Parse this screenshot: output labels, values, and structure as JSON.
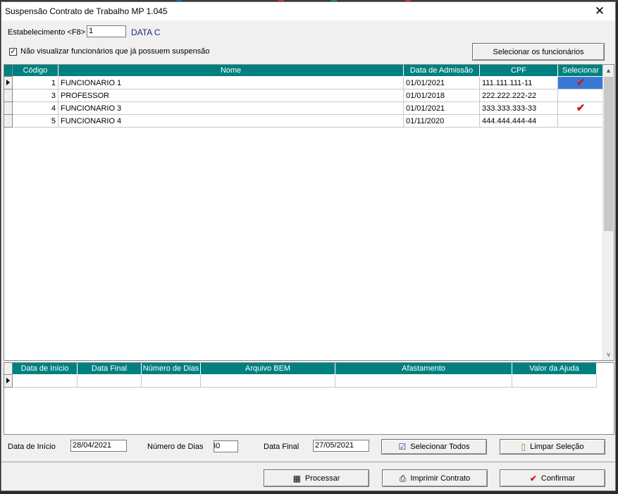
{
  "window": {
    "title": "Suspensão Contrato de Trabalho MP 1.045",
    "close_glyph": "✕"
  },
  "estab": {
    "label": "Estabelecimento <F8>",
    "value": "1",
    "name": "DATA C"
  },
  "filter": {
    "label": "Não visualizar funcionários que já possuem suspensão",
    "checked": true,
    "check_glyph": "✓"
  },
  "select_button": "Selecionar os funcionários",
  "grid": {
    "columns": [
      "Código",
      "Nome",
      "Data de Admissão",
      "CPF",
      "Selecionar"
    ],
    "rows": [
      {
        "codigo": "1",
        "nome": "FUNCIONARIO 1",
        "admissao": "01/01/2021",
        "cpf": "111.111.111-11",
        "selecionar": true
      },
      {
        "codigo": "3",
        "nome": "PROFESSOR",
        "admissao": "01/01/2018",
        "cpf": "222.222.222-22",
        "selecionar": false
      },
      {
        "codigo": "4",
        "nome": "FUNCIONARIO 3",
        "admissao": "01/01/2021",
        "cpf": "333.333.333-33",
        "selecionar": true
      },
      {
        "codigo": "5",
        "nome": "FUNCIONARIO 4",
        "admissao": "01/11/2020",
        "cpf": "444.444.444-44",
        "selecionar": false
      }
    ],
    "check_glyph": "✔",
    "scroll_up": "▲",
    "scroll_down": "∨"
  },
  "periods": {
    "columns": [
      "Data de Início",
      "Data Final",
      "Número de Dias",
      "Arquivo BEM",
      "Afastamento",
      "Valor da Ajuda"
    ]
  },
  "form": {
    "inicio_label": "Data de Início",
    "inicio_value": "28/04/2021",
    "dias_label": "Número de Dias",
    "dias_value": "30",
    "final_label": "Data Final",
    "final_value": "27/05/2021"
  },
  "buttons": {
    "selecionar_todos": "Selecionar Todos",
    "limpar_selecao": "Limpar Seleção",
    "processar": "Processar",
    "imprimir": "Imprimir Contrato",
    "confirmar": "Confirmar"
  },
  "icons": {
    "selecionar_todos": "list-check-icon",
    "limpar_selecao": "blank-page-icon",
    "processar": "process-icon",
    "imprimir": "printer-icon",
    "confirmar": "checkmark-icon"
  },
  "colors": {
    "header": "#008080",
    "selection": "#3a78d8",
    "check": "#d01818"
  }
}
